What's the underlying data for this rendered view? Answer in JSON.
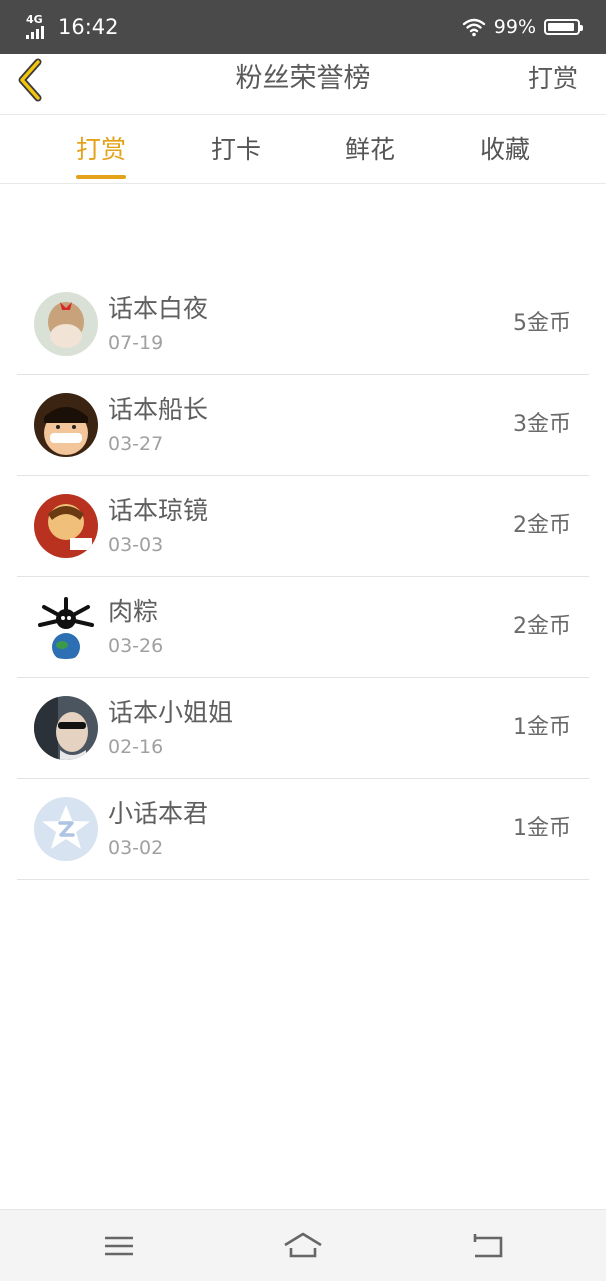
{
  "status_bar": {
    "network": "4G",
    "time": "16:42",
    "battery": "99%"
  },
  "header": {
    "title": "粉丝荣誉榜",
    "action": "打赏",
    "back_icon": "chevron-left-icon",
    "accent_color": "#e3a21a"
  },
  "tabs": [
    {
      "label": "打赏",
      "active": true
    },
    {
      "label": "打卡",
      "active": false
    },
    {
      "label": "鲜花",
      "active": false
    },
    {
      "label": "收藏",
      "active": false
    }
  ],
  "fans": [
    {
      "name": "话本白夜",
      "date": "07-19",
      "amount": "5金币"
    },
    {
      "name": "话本船长",
      "date": "03-27",
      "amount": "3金币"
    },
    {
      "name": "话本琼镜",
      "date": "03-03",
      "amount": "2金币"
    },
    {
      "name": "肉粽",
      "date": "03-26",
      "amount": "2金币"
    },
    {
      "name": "话本小姐姐",
      "date": "02-16",
      "amount": "1金币"
    },
    {
      "name": "小话本君",
      "date": "03-02",
      "amount": "1金币"
    }
  ],
  "nav_bar": {
    "menu_icon": "menu-icon",
    "home_icon": "home-icon",
    "back_icon": "back-icon"
  }
}
